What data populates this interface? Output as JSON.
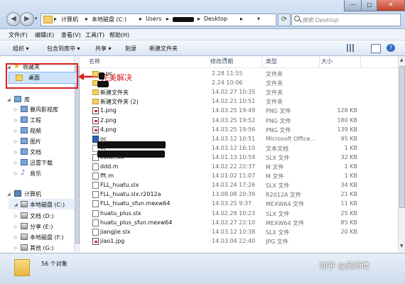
{
  "window": {
    "breadcrumb": [
      "计算机",
      "本地磁盘 (C:)",
      "Users",
      "Desktop"
    ],
    "search_placeholder": "搜索 Desktop",
    "controls": {
      "minimize": "—",
      "maximize": "□",
      "close": "✕"
    }
  },
  "menu": [
    "文件(F)",
    "编辑(E)",
    "查看(V)",
    "工具(T)",
    "帮助(H)"
  ],
  "toolbar": [
    "组织 ▾",
    "包含到库中 ▾",
    "共享 ▾",
    "刻录",
    "新建文件夹"
  ],
  "nav": {
    "favorites": "收藏夹",
    "desktop": "桌面",
    "library": "库",
    "libraries": [
      "暴风影视库",
      "工程",
      "视频",
      "图片",
      "文档",
      "迅雷下载",
      "音乐"
    ],
    "computer": "计算机",
    "drives": [
      "本地磁盘 (C:)",
      "文档 (D:)",
      "分享 (E:)",
      "本地磁盘 (F:)",
      "其他 (G:)"
    ]
  },
  "annotation": "完美解决",
  "columns": {
    "name": "名称",
    "date": "修改日期",
    "type": "类型",
    "size": "大小"
  },
  "files": [
    {
      "name": "...pc",
      "date": "2.28 11:55",
      "type": "文件夹",
      "size": "",
      "icon": "folder"
    },
    {
      "name": "",
      "date": "2.24 10:06",
      "type": "文件夹",
      "size": "",
      "icon": "folder"
    },
    {
      "name": "新建文件夹",
      "date": "14.02.27 10:35",
      "type": "文件夹",
      "size": "",
      "icon": "folder"
    },
    {
      "name": "新建文件夹 (2)",
      "date": "14.02.21 10:51",
      "type": "文件夹",
      "size": "",
      "icon": "folder"
    },
    {
      "name": "1.png",
      "date": "14.03.25 19:49",
      "type": "PNG 文件",
      "size": "128 KB",
      "icon": "img"
    },
    {
      "name": "2.png",
      "date": "14.03.25 19:52",
      "type": "PNG 文件",
      "size": "180 KB",
      "icon": "img"
    },
    {
      "name": "4.png",
      "date": "14.03.25 19:56",
      "type": "PNG 文件",
      "size": "139 KB",
      "icon": "img"
    },
    {
      "name": "oc",
      "date": "14.03.12 10:51",
      "type": "Microsoft Office...",
      "size": "95 KB",
      "icon": "word"
    },
    {
      "name": "xt",
      "date": "14.03.12 16:10",
      "type": "文本文档",
      "size": "1 KB",
      "icon": "txt"
    },
    {
      "name": "contr.slx",
      "date": "14.01.13 10:59",
      "type": "SLX 文件",
      "size": "32 KB",
      "icon": "doc"
    },
    {
      "name": "ddd.m",
      "date": "14.02.22 22:37",
      "type": "M 文件",
      "size": "1 KB",
      "icon": "doc"
    },
    {
      "name": "fft.m",
      "date": "14.01.02 11:07",
      "type": "M 文件",
      "size": "1 KB",
      "icon": "doc"
    },
    {
      "name": "FLL_huatu.slx",
      "date": "14.03.24 17:26",
      "type": "SLX 文件",
      "size": "34 KB",
      "icon": "doc"
    },
    {
      "name": "FLL_huatu.slx.r2012a",
      "date": "13.08.08 20:39",
      "type": "R2012A 文件",
      "size": "21 KB",
      "icon": "doc"
    },
    {
      "name": "FLL_huatu_sfun.mexw64",
      "date": "14.03.25 9:37",
      "type": "MEXW64 文件",
      "size": "11 KB",
      "icon": "doc"
    },
    {
      "name": "huatu_plus.slx",
      "date": "14.02.28 10:23",
      "type": "SLX 文件",
      "size": "25 KB",
      "icon": "doc"
    },
    {
      "name": "huatu_plus_sfun.mexw64",
      "date": "14.02.27 22:10",
      "type": "MEXW64 文件",
      "size": "85 KB",
      "icon": "doc"
    },
    {
      "name": "jiangjie.slx",
      "date": "14.03.12 10:38",
      "type": "SLX 文件",
      "size": "20 KB",
      "icon": "doc"
    },
    {
      "name": "jiao1.jpg",
      "date": "14.03.04 22:40",
      "type": "JPG 文件",
      "size": "",
      "icon": "img"
    }
  ],
  "status": {
    "count": "56 个对象"
  },
  "watermark": "知乎 @吴師傅"
}
